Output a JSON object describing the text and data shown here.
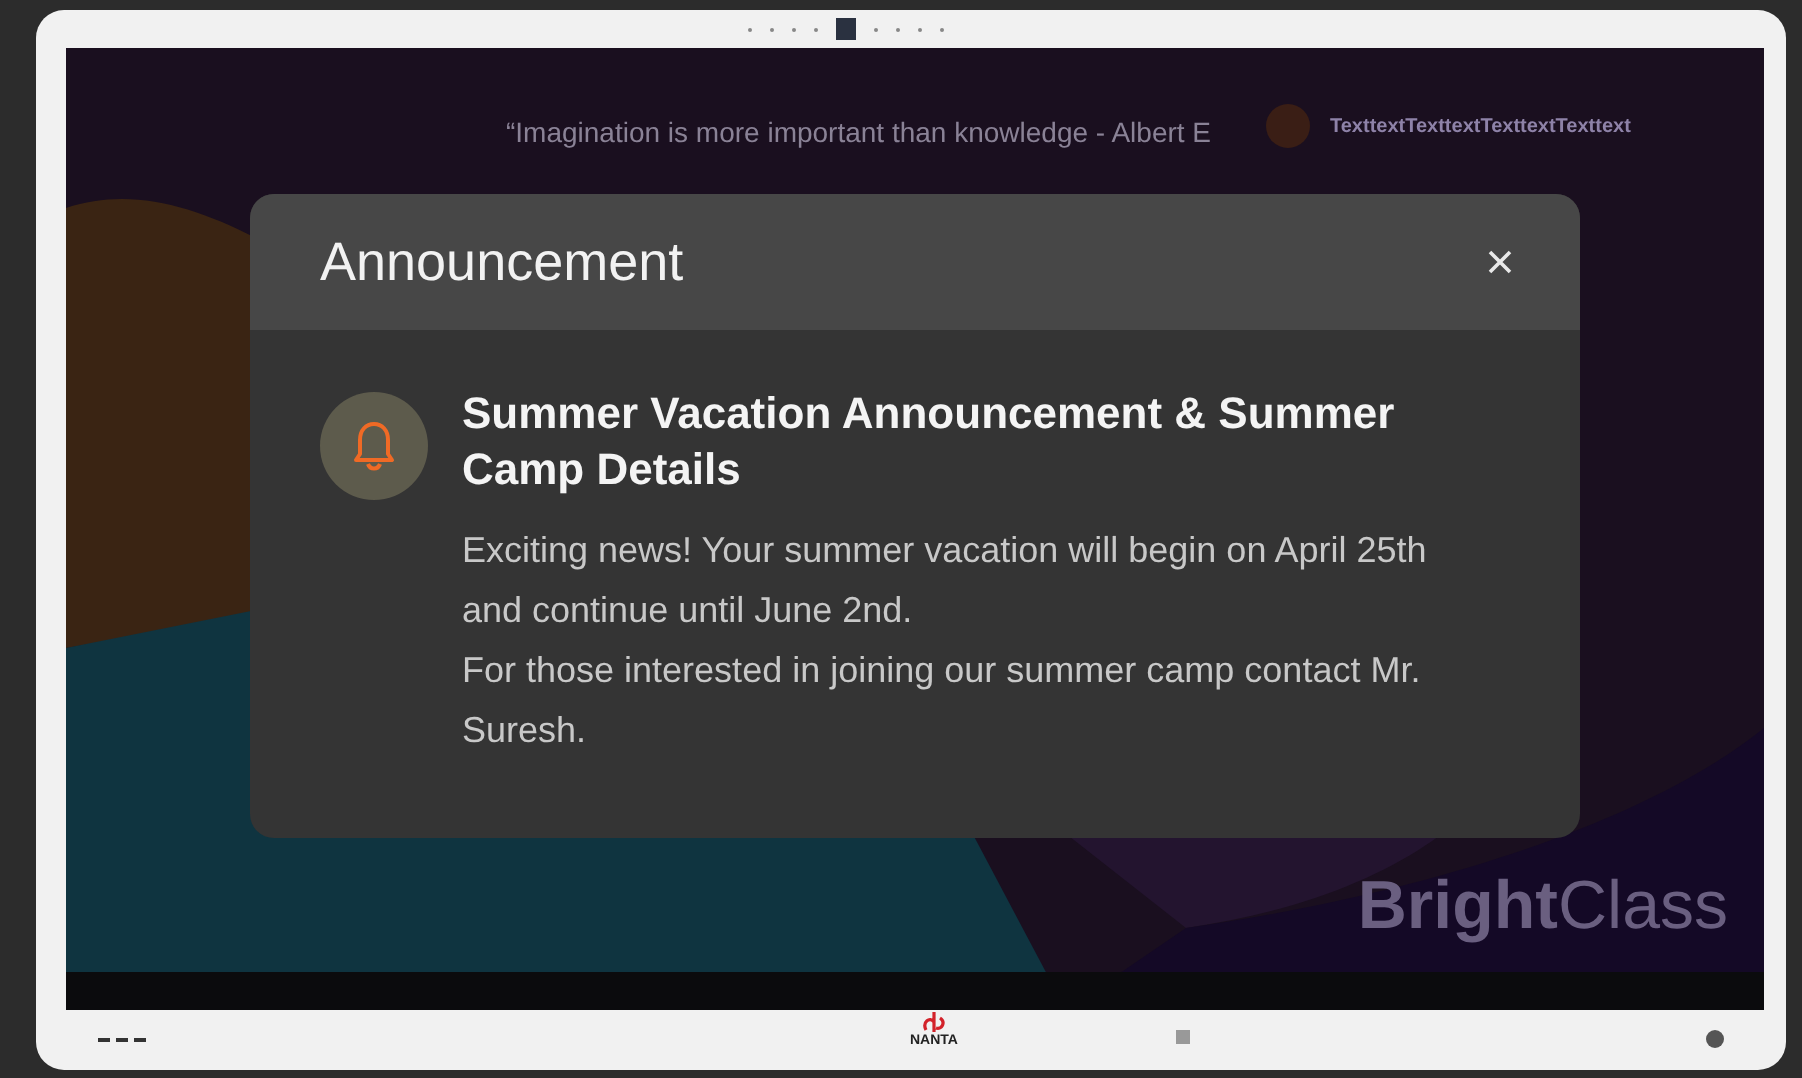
{
  "background": {
    "quote": "“Imagination is more important than knowledge - Albert E",
    "notification_title": "TexttextTexttextTexttextTexttext",
    "brand": "**Bright**Class"
  },
  "dialog": {
    "title": "Announcement",
    "heading": "Summer Vacation Announcement & Summer Camp Details",
    "paragraphs": [
      "Exciting news! Your summer vacation will begin on April 25th and continue until June 2nd.",
      "For those interested in joining our summer camp contact Mr. Suresh."
    ]
  },
  "bezel": {
    "logo": "NANTA"
  }
}
